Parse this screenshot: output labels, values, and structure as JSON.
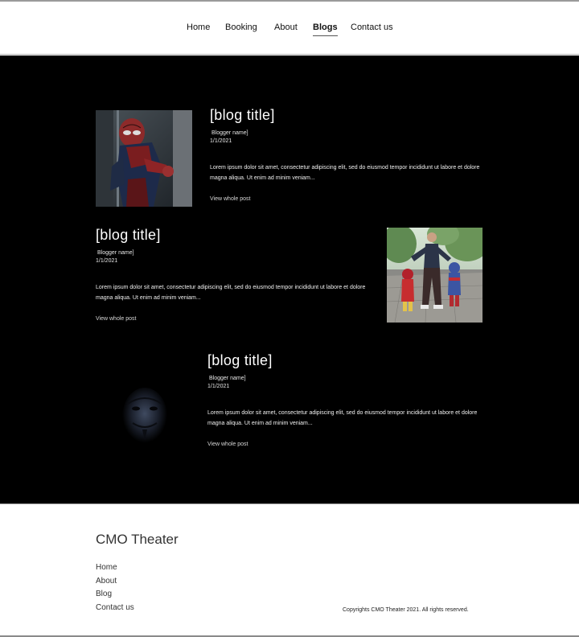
{
  "nav": {
    "items": [
      {
        "label": "Home"
      },
      {
        "label": "Booking"
      },
      {
        "label": "About"
      },
      {
        "label": "Blogs",
        "active": true
      },
      {
        "label": "Contact us"
      }
    ]
  },
  "posts": [
    {
      "title": "[blog title]",
      "author": "Blogger name]",
      "date": "1/1/2021",
      "excerpt": "Lorem ipsum dolor sit amet, consectetur adipiscing elit, sed do eiusmod tempor incididunt ut labore et dolore magna aliqua. Ut enim ad minim veniam...",
      "link_label": "View whole post",
      "image": "spiderman-photo"
    },
    {
      "title": "[blog title]",
      "author": "Blogger name]",
      "date": "1/1/2021",
      "excerpt": "Lorem ipsum dolor sit amet, consectetur adipiscing elit, sed do eiusmod tempor incididunt ut labore et dolore magna aliqua. Ut enim ad minim veniam...",
      "link_label": "View whole post",
      "image": "kids-superheroes-photo"
    },
    {
      "title": "[blog title]",
      "author": "Blogger name]",
      "date": "1/1/2021",
      "excerpt": "Lorem ipsum dolor sit amet, consectetur adipiscing elit, sed do eiusmod tempor incididunt ut labore et dolore magna aliqua. Ut enim ad minim veniam...",
      "link_label": "View whole post",
      "image": "guy-fawkes-mask-photo"
    }
  ],
  "footer": {
    "brand": "CMO Theater",
    "links": [
      "Home",
      "About",
      "Blog",
      "Contact us"
    ],
    "copyright": "Copyrights CMO Theater 2021. All rights reserved."
  },
  "colors": {
    "main_background": "#000000",
    "page_background": "#ffffff"
  }
}
